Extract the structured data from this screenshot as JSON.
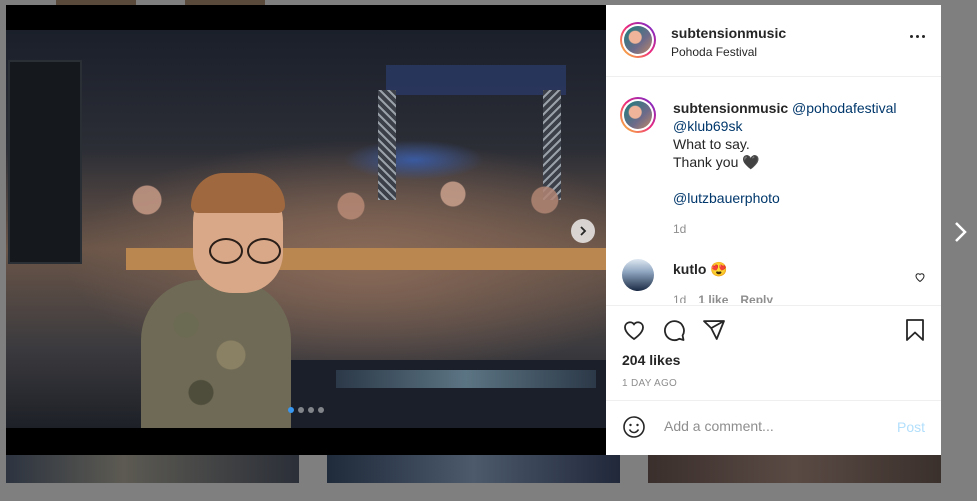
{
  "post": {
    "header": {
      "username": "subtensionmusic",
      "location": "Pohoda Festival"
    },
    "caption": {
      "username": "subtensionmusic",
      "mentions": [
        "@pohodafestival",
        "@klub69sk"
      ],
      "line1": "What to say.",
      "line2": "Thank you 🖤",
      "photo_credit": "@lutzbauerphoto",
      "time": "1d"
    },
    "comments": [
      {
        "username": "kutlo",
        "text": "😍",
        "time": "1d",
        "likes": "1 like",
        "reply_label": "Reply"
      }
    ],
    "likes": "204 likes",
    "date": "1 DAY AGO",
    "add_comment": {
      "placeholder": "Add a comment...",
      "post_label": "Post"
    },
    "carousel": {
      "slide_count": 4,
      "active_index": 0
    }
  },
  "colors": {
    "link": "#00376b",
    "carousel_active_dot": "#3897f0",
    "post_disabled": "#b2dffc",
    "story_ring": [
      "#f9ce34",
      "#ee2a7b",
      "#6228d7"
    ]
  },
  "icons": {
    "more": "more-horizontal-icon",
    "next_media": "chevron-right-icon",
    "next_post": "chevron-right-icon",
    "like": "heart-icon",
    "comment": "comment-bubble-icon",
    "share": "paper-plane-icon",
    "save": "bookmark-icon",
    "emoji": "smiley-icon",
    "comment_like": "heart-icon"
  }
}
